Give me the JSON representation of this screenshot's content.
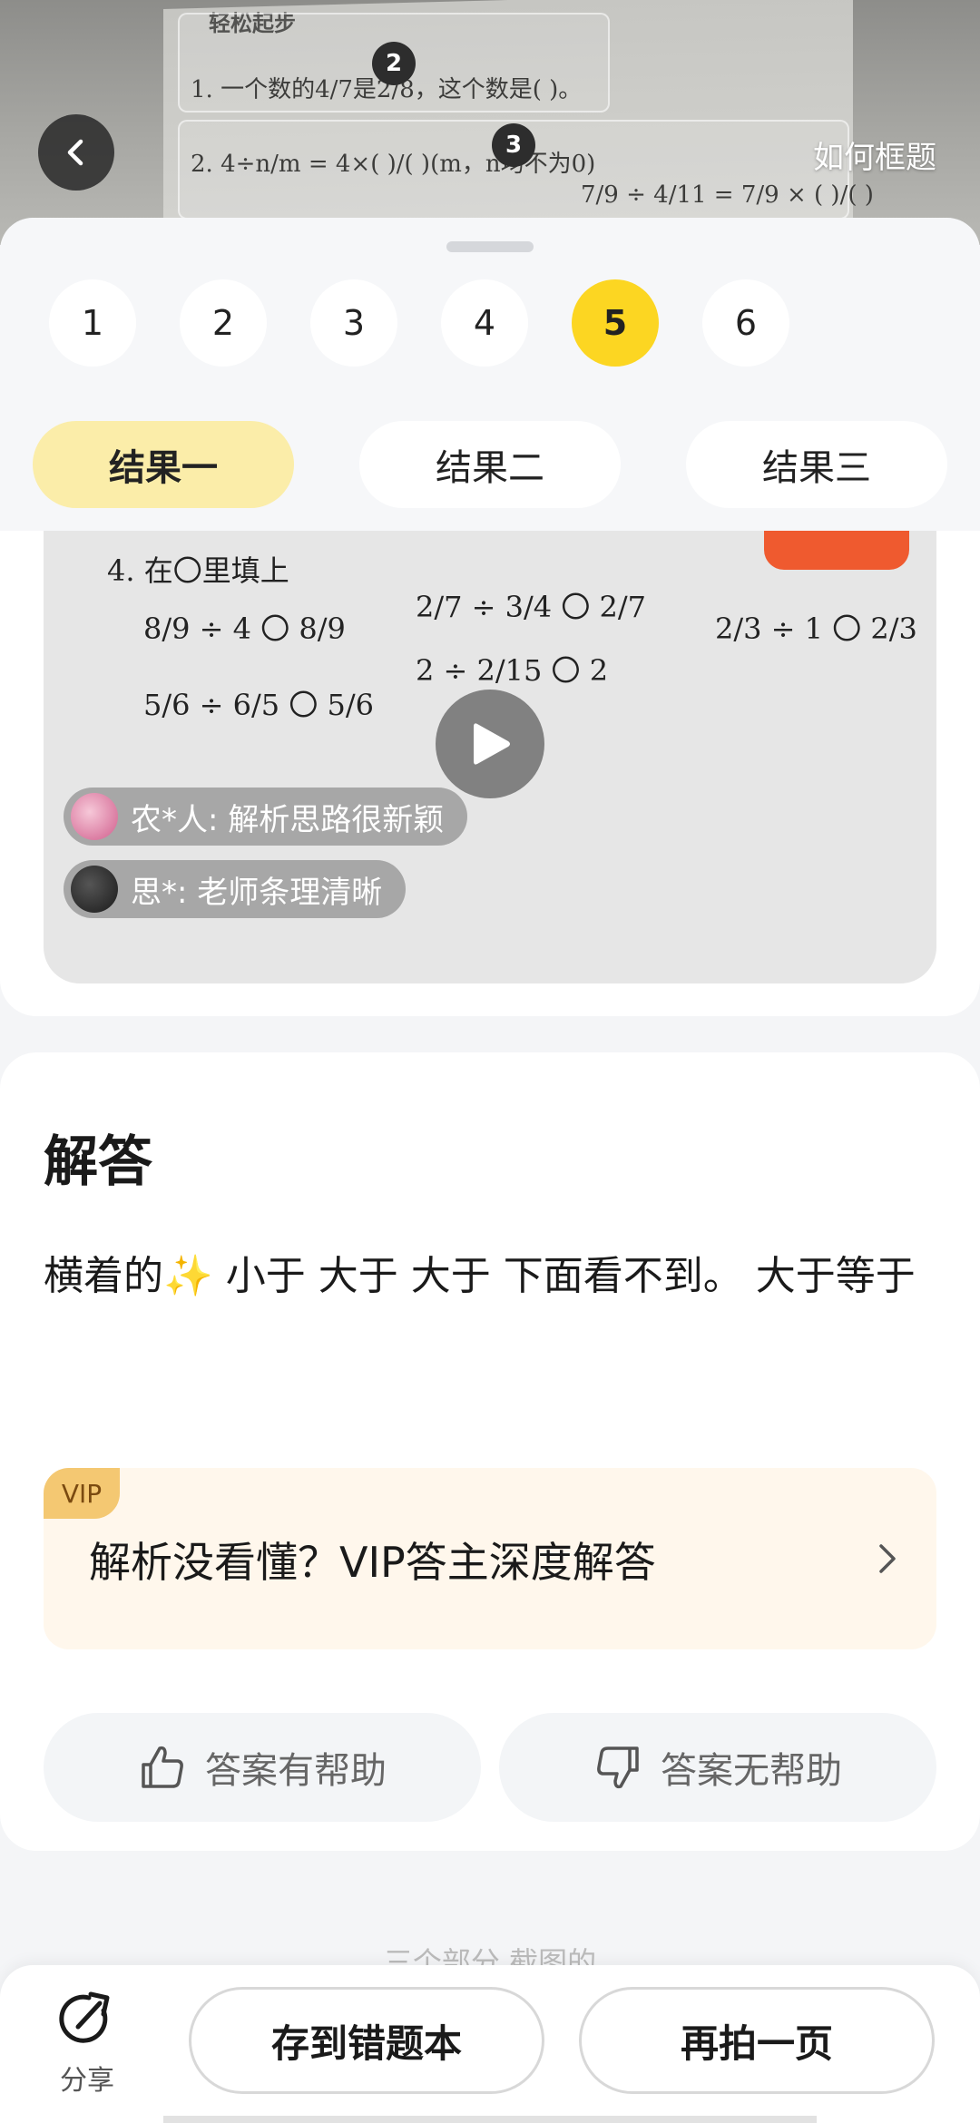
{
  "photo": {
    "section_label": "轻松起步",
    "line1": "1. 一个数的4/7是2/8，这个数是(    )。",
    "line2": "2. 4÷n/m = 4×(  )/(  )(m，n均不为0)",
    "line3": "7/9 ÷ 4/11 = 7/9 × (  )/(  )",
    "markers": [
      "2",
      "3"
    ]
  },
  "header": {
    "how_to_frame": "如何框题"
  },
  "question_tabs": [
    "1",
    "2",
    "3",
    "4",
    "5",
    "6"
  ],
  "active_question": "5",
  "result_tabs": [
    "结果一",
    "结果二",
    "结果三"
  ],
  "active_result": "结果一",
  "video": {
    "q_prefix": "4. 在〇里填上",
    "rows": [
      "8/9 ÷ 4 〇 8/9",
      "5/6 ÷ 6/5 〇 5/6",
      "2/7 ÷ 3/4 〇 2/7",
      "2 ÷ 2/15 〇 2",
      "2/3 ÷ 1 〇 2/3"
    ],
    "comments": [
      {
        "user": "农*人: 解析思路很新颖"
      },
      {
        "user": "思*: 老师条理清晰"
      }
    ]
  },
  "answer": {
    "title": "解答",
    "text_before": "横着的",
    "sparkle": "✨",
    "text_after": " 小于 大于 大于 下面看不到。 大于等于"
  },
  "vip": {
    "badge": "VIP",
    "text": "解析没看懂？VIP答主深度解答"
  },
  "feedback": {
    "helpful": "答案有帮助",
    "not_helpful": "答案无帮助"
  },
  "bottom": {
    "faded_text": "三个部分 截图的",
    "share_label": "分享",
    "save_wrong": "存到错题本",
    "retake": "再拍一页"
  }
}
